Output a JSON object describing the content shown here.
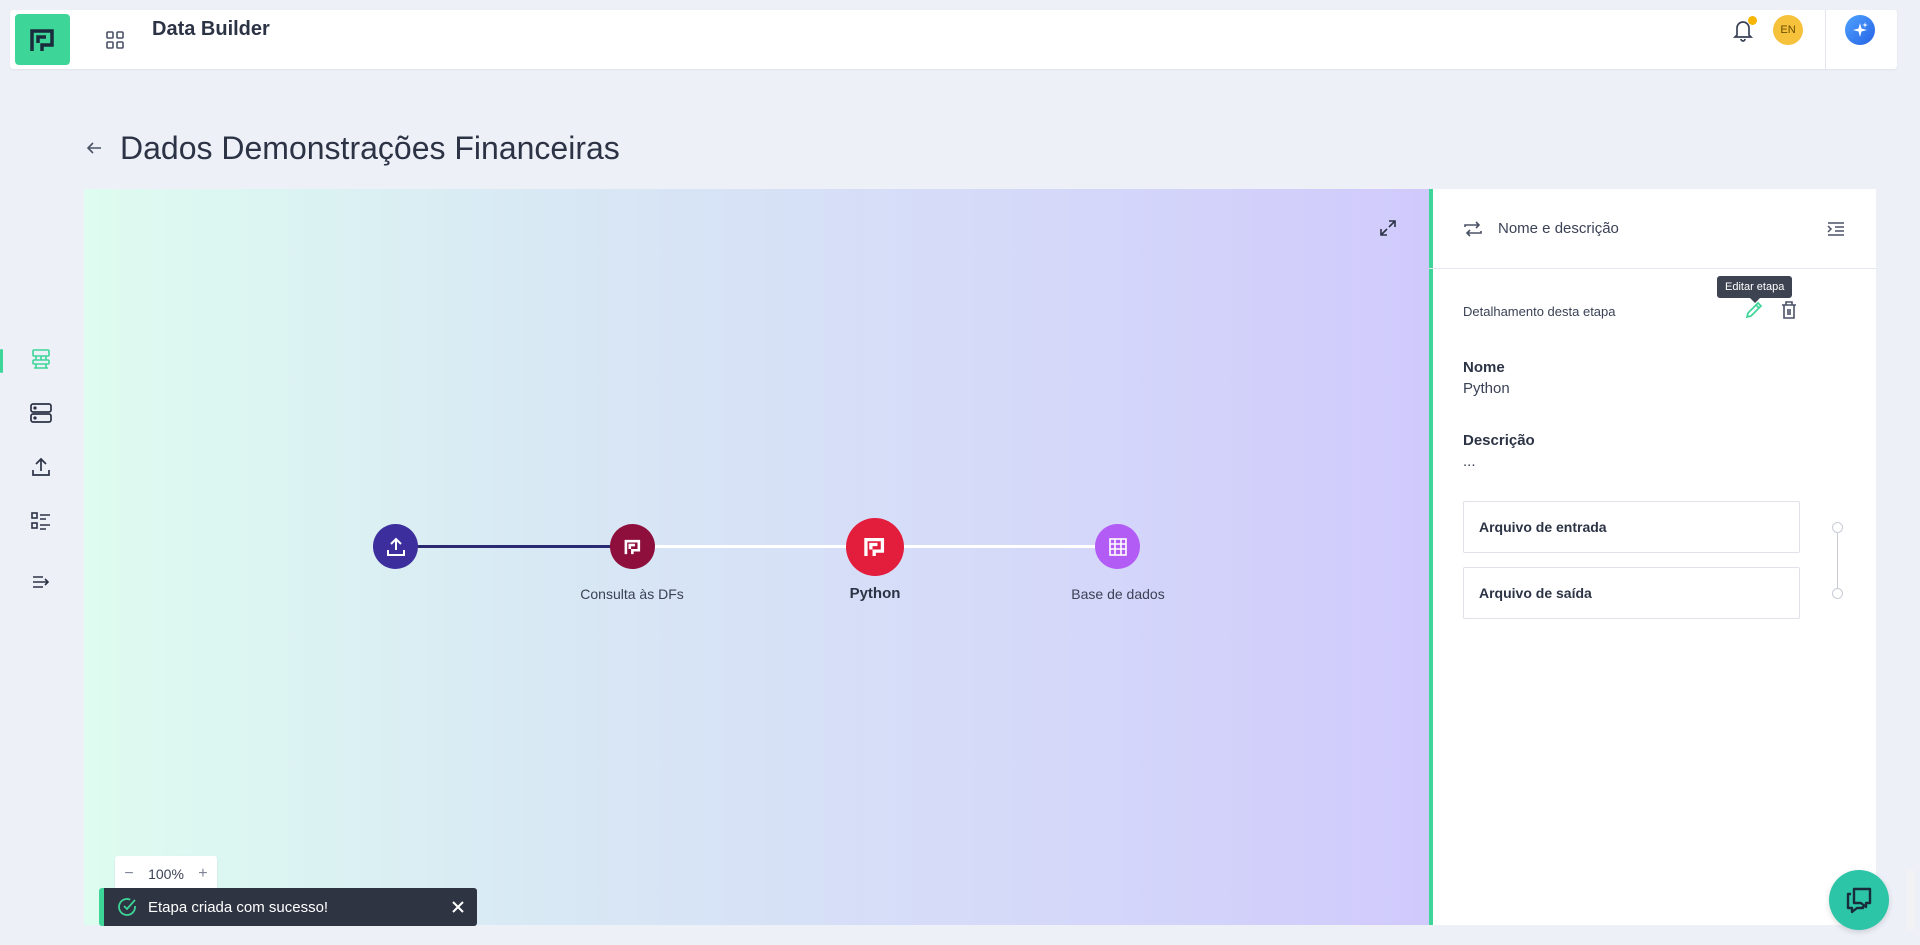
{
  "header": {
    "app_title": "Data Builder",
    "language": "EN",
    "icons": [
      "logo-icon",
      "apps-grid-icon",
      "bell-icon",
      "ai-assistant-icon"
    ],
    "brand_color": "#3dd598"
  },
  "sidebar": {
    "items": [
      {
        "icon": "pipeline-icon",
        "active": true
      },
      {
        "icon": "database-icon",
        "active": false
      },
      {
        "icon": "upload-icon",
        "active": false
      },
      {
        "icon": "checklist-icon",
        "active": false
      },
      {
        "icon": "expand-menu-icon",
        "active": false
      }
    ]
  },
  "page": {
    "title": "Dados Demonstrações Financeiras"
  },
  "flow": {
    "nodes": [
      {
        "label": "",
        "icon": "upload-icon",
        "color": "#3d2e9e"
      },
      {
        "label": "Consulta às DFs",
        "icon": "logo-icon",
        "color": "#8e0f3c"
      },
      {
        "label": "Python",
        "icon": "logo-icon",
        "color": "#e31d3c",
        "selected": true
      },
      {
        "label": "Base de dados",
        "icon": "table-icon",
        "color": "#b25cf5"
      }
    ],
    "zoom": "100%",
    "zoom_out": "−",
    "zoom_in": "+"
  },
  "panel": {
    "title": "Nome e descrição",
    "section_title": "Detalhamento desta etapa",
    "edit_tooltip": "Editar etapa",
    "name_label": "Nome",
    "name_value": "Python",
    "description_label": "Descrição",
    "description_value": "...",
    "input_file_label": "Arquivo de entrada",
    "output_file_label": "Arquivo de saída"
  },
  "toast": {
    "message": "Etapa criada com sucesso!"
  }
}
